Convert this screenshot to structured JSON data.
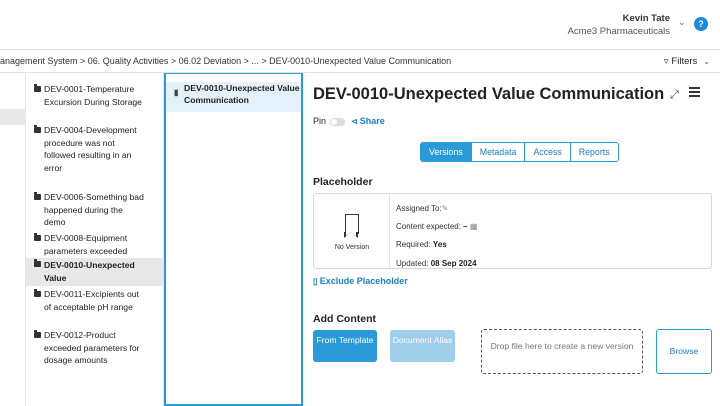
{
  "header": {
    "user_name": "Kevin Tate",
    "org_name": "Acme3 Pharmaceuticals",
    "help_label": "?"
  },
  "breadcrumb": {
    "text": "anagement System > 06. Quality Activities > 06.02 Deviation > ... > DEV-0010-Unexpected Value Communication"
  },
  "filters": {
    "label": "Filters"
  },
  "tree": {
    "items": [
      {
        "label": "DEV-0001-Temperature Excursion During Storage",
        "selected": false
      },
      {
        "label": "DEV-0004-Development procedure was not followed resulting in an error",
        "selected": false
      },
      {
        "label": "DEV-0006-Something bad happened during the demo",
        "selected": false
      },
      {
        "label": "DEV-0008-Equipment parameters exceeded",
        "selected": false
      },
      {
        "label": "DEV-0010-Unexpected Value",
        "selected": true
      },
      {
        "label": "DEV-0011-Excipients out of acceptable pH range",
        "selected": false
      },
      {
        "label": "DEV-0012-Product exceeded parameters for dosage amounts",
        "selected": false
      }
    ]
  },
  "doclist": {
    "items": [
      {
        "label": "DEV-0010-Unexpected Value Communication"
      }
    ]
  },
  "detail": {
    "title": "DEV-0010-Unexpected Value Communication",
    "pin_label": "Pin",
    "share_label": "Share",
    "tabs": [
      {
        "label": "Versions",
        "active": true
      },
      {
        "label": "Metadata",
        "active": false
      },
      {
        "label": "Access",
        "active": false
      },
      {
        "label": "Reports",
        "active": false
      }
    ],
    "placeholder": {
      "heading": "Placeholder",
      "no_version": "No Version",
      "assigned_label": "Assigned To:",
      "content_expected_label": "Content expected:",
      "content_expected_value": "–",
      "required_label": "Required:",
      "required_value": "Yes",
      "updated_label": "Updated:",
      "updated_value": "08 Sep 2024"
    },
    "exclude_label": "Exclude Placeholder",
    "add_content": {
      "heading": "Add Content",
      "from_template": "From Template",
      "document_alias": "Document Alias",
      "drop_text": "Drop file here to create a new version",
      "browse": "Browse"
    }
  },
  "colors": {
    "accent": "#2a9ad8",
    "link": "#1c7fc8",
    "selected_bg": "#e8e8e8",
    "doc_selected_bg": "#e4f1fa"
  }
}
